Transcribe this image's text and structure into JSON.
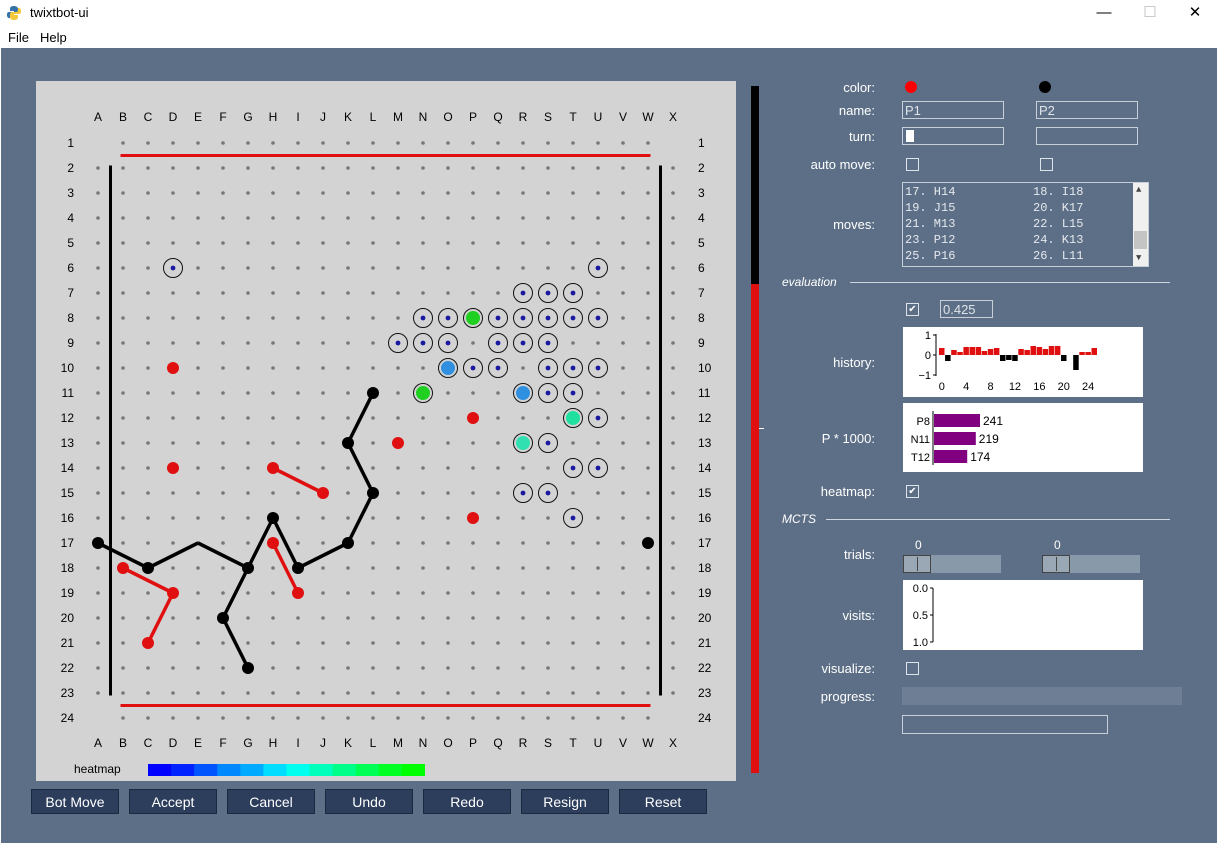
{
  "window": {
    "title": "twixtbot-ui",
    "minimize": "—",
    "maximize": "☐",
    "close": "✕"
  },
  "menu": [
    "File",
    "Help"
  ],
  "board": {
    "columns": [
      "A",
      "B",
      "C",
      "D",
      "E",
      "F",
      "G",
      "H",
      "I",
      "J",
      "K",
      "L",
      "M",
      "N",
      "O",
      "P",
      "Q",
      "R",
      "S",
      "T",
      "U",
      "V",
      "W",
      "X"
    ],
    "rows": 24,
    "red_pegs": [
      "D10",
      "P12",
      "M13",
      "D14",
      "H14",
      "J15",
      "P16",
      "H17",
      "B18",
      "D19",
      "I19",
      "C21"
    ],
    "black_pegs": [
      "L11",
      "K13",
      "L15",
      "H16",
      "A17",
      "K17",
      "W17",
      "C18",
      "G18",
      "I18",
      "F20",
      "G22"
    ],
    "red_links": [
      [
        "H14",
        "J15"
      ],
      [
        "H17",
        "I19"
      ],
      [
        "B18",
        "D19"
      ],
      [
        "D19",
        "C21"
      ]
    ],
    "black_links": [
      [
        "L11",
        "K13"
      ],
      [
        "K13",
        "L15"
      ],
      [
        "L15",
        "K17"
      ],
      [
        "K17",
        "I18"
      ],
      [
        "I18",
        "H16"
      ],
      [
        "H16",
        "G18"
      ],
      [
        "A17",
        "C18"
      ],
      [
        "C18",
        "E17"
      ],
      [
        "E17",
        "G18"
      ],
      [
        "G18",
        "F20"
      ],
      [
        "F20",
        "G22"
      ]
    ],
    "candidate_moves": [
      "D6",
      "U6",
      "R7",
      "S7",
      "T7",
      "N8",
      "O8",
      "Q8",
      "R8",
      "S8",
      "T8",
      "U8",
      "M9",
      "N9",
      "O9",
      "Q9",
      "R9",
      "S9",
      "P10",
      "Q10",
      "S10",
      "T10",
      "U10",
      "S11",
      "T11",
      "U12",
      "S13",
      "T14",
      "U14",
      "R15",
      "S15",
      "T16"
    ],
    "heat_cells": [
      {
        "cell": "P8",
        "color": "#20d020"
      },
      {
        "cell": "N11",
        "color": "#20d020"
      },
      {
        "cell": "T12",
        "color": "#20e0a0"
      },
      {
        "cell": "R13",
        "color": "#30e0b0"
      },
      {
        "cell": "O10",
        "color": "#3090e0"
      },
      {
        "cell": "R11",
        "color": "#3090e0"
      }
    ],
    "heatmap_label": "heatmap",
    "heatmap_colors": [
      "#0000ff",
      "#0022ff",
      "#0055ff",
      "#0088ff",
      "#00aaff",
      "#00ddff",
      "#00ffee",
      "#00ffbb",
      "#00ff88",
      "#00ff55",
      "#00ff22",
      "#00ff00"
    ]
  },
  "eval_bar": {
    "red_fraction": 0.712
  },
  "buttons": [
    "Bot Move",
    "Accept",
    "Cancel",
    "Undo",
    "Redo",
    "Resign",
    "Reset"
  ],
  "panel": {
    "color_label": "color:",
    "name_label": "name:",
    "turn_label": "turn:",
    "auto_move_label": "auto move:",
    "moves_label": "moves:",
    "p1": {
      "color": "#ff0000",
      "name": "P1"
    },
    "p2": {
      "color": "#000000",
      "name": "P2"
    },
    "moves": [
      [
        "17. H14",
        "18. I18"
      ],
      [
        "19. J15",
        "20. K17"
      ],
      [
        "21. M13",
        "22. L15"
      ],
      [
        "23. P12",
        "24. K13"
      ],
      [
        "25. P16",
        "26. L11"
      ]
    ],
    "evaluation_title": "evaluation",
    "evaluation_value": "0.425",
    "history_label": "history:",
    "p1000_label": "P * 1000:",
    "heatmap_label": "heatmap:",
    "mcts_title": "MCTS",
    "trials_label": "trials:",
    "trials_p1": "0",
    "trials_p2": "0",
    "visits_label": "visits:",
    "visualize_label": "visualize:",
    "progress_label": "progress:"
  },
  "chart_data": [
    {
      "type": "bar",
      "title": "",
      "xlabel": "",
      "ylabel": "",
      "x_ticks": [
        "0",
        "4",
        "8",
        "12",
        "16",
        "20",
        "24"
      ],
      "y_ticks": [
        "1",
        "0",
        "−1"
      ],
      "ylim": [
        -1,
        1
      ],
      "values": [
        0.35,
        -0.3,
        0.25,
        0.15,
        0.4,
        0.4,
        0.4,
        0.2,
        0.3,
        0.35,
        -0.3,
        -0.25,
        -0.3,
        0.3,
        0.25,
        0.45,
        0.4,
        0.3,
        0.45,
        0.45,
        -0.3,
        0.0,
        -0.75,
        0.15,
        0.15,
        0.35
      ]
    },
    {
      "type": "bar",
      "orientation": "horizontal",
      "categories": [
        "P8",
        "N11",
        "T12"
      ],
      "values": [
        241,
        219,
        174
      ],
      "color": "#800080"
    },
    {
      "type": "bar",
      "orientation": "horizontal",
      "y_ticks": [
        "0.0",
        "0.5",
        "1.0"
      ],
      "categories": [],
      "values": []
    }
  ]
}
